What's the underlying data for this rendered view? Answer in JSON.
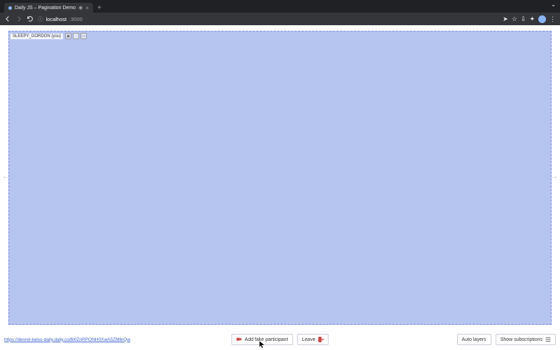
{
  "browser": {
    "tab_title": "Daily JS – Pagination Demo",
    "url_host": "localhost",
    "url_port": ":3000"
  },
  "tile": {
    "participant_name": "SLEEPY_GORDON",
    "you_suffix": " (you)"
  },
  "bottom": {
    "room_url": "https://devrel-kelso-daily.daily.co/6l0ZnRPONH0XwA5ZM6rQw",
    "add_fake": "Add fake participant",
    "leave": "Leave",
    "auto_layers": "Auto layers",
    "show_subs": "Show subscriptions"
  }
}
